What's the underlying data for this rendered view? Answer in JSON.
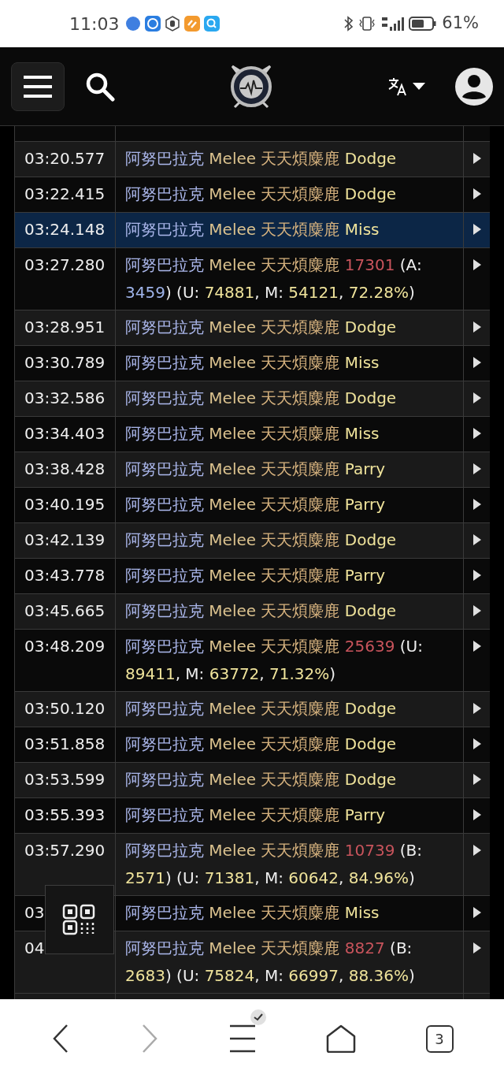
{
  "status_bar": {
    "time": "11:03",
    "battery": "61%"
  },
  "log": {
    "rows": [
      {
        "time": "03:20.577",
        "selected": false,
        "segments": [
          {
            "kind": "source",
            "text": "阿努巴拉克"
          },
          {
            "kind": "ability",
            "text": "Melee"
          },
          {
            "kind": "target",
            "text": "天天煩麋鹿"
          },
          {
            "kind": "result",
            "text": "Dodge"
          }
        ]
      },
      {
        "time": "03:22.415",
        "selected": false,
        "segments": [
          {
            "kind": "source",
            "text": "阿努巴拉克"
          },
          {
            "kind": "ability",
            "text": "Melee"
          },
          {
            "kind": "target",
            "text": "天天煩麋鹿"
          },
          {
            "kind": "result",
            "text": "Dodge"
          }
        ]
      },
      {
        "time": "03:24.148",
        "selected": true,
        "segments": [
          {
            "kind": "source",
            "text": "阿努巴拉克"
          },
          {
            "kind": "ability",
            "text": "Melee"
          },
          {
            "kind": "target",
            "text": "天天煩麋鹿"
          },
          {
            "kind": "result",
            "text": "Miss"
          }
        ]
      },
      {
        "time": "03:27.280",
        "selected": false,
        "segments": [
          {
            "kind": "source",
            "text": "阿努巴拉克"
          },
          {
            "kind": "ability",
            "text": "Melee"
          },
          {
            "kind": "target",
            "text": "天天煩麋鹿"
          },
          {
            "kind": "damage",
            "text": "17301"
          },
          {
            "kind": "plain",
            "text": "(A:"
          },
          {
            "kind": "absorb",
            "text": "3459"
          },
          {
            "kind": "plain",
            "text": ")"
          },
          {
            "kind": "plain",
            "text": "(U:"
          },
          {
            "kind": "number",
            "text": "74881"
          },
          {
            "kind": "plain",
            "text": ", M:"
          },
          {
            "kind": "number",
            "text": "54121"
          },
          {
            "kind": "plain",
            "text": ","
          },
          {
            "kind": "number",
            "text": "72.28%"
          },
          {
            "kind": "plain",
            "text": ")"
          }
        ]
      },
      {
        "time": "03:28.951",
        "selected": false,
        "segments": [
          {
            "kind": "source",
            "text": "阿努巴拉克"
          },
          {
            "kind": "ability",
            "text": "Melee"
          },
          {
            "kind": "target",
            "text": "天天煩麋鹿"
          },
          {
            "kind": "result",
            "text": "Dodge"
          }
        ]
      },
      {
        "time": "03:30.789",
        "selected": false,
        "segments": [
          {
            "kind": "source",
            "text": "阿努巴拉克"
          },
          {
            "kind": "ability",
            "text": "Melee"
          },
          {
            "kind": "target",
            "text": "天天煩麋鹿"
          },
          {
            "kind": "result",
            "text": "Miss"
          }
        ]
      },
      {
        "time": "03:32.586",
        "selected": false,
        "segments": [
          {
            "kind": "source",
            "text": "阿努巴拉克"
          },
          {
            "kind": "ability",
            "text": "Melee"
          },
          {
            "kind": "target",
            "text": "天天煩麋鹿"
          },
          {
            "kind": "result",
            "text": "Dodge"
          }
        ]
      },
      {
        "time": "03:34.403",
        "selected": false,
        "segments": [
          {
            "kind": "source",
            "text": "阿努巴拉克"
          },
          {
            "kind": "ability",
            "text": "Melee"
          },
          {
            "kind": "target",
            "text": "天天煩麋鹿"
          },
          {
            "kind": "result",
            "text": "Miss"
          }
        ]
      },
      {
        "time": "03:38.428",
        "selected": false,
        "segments": [
          {
            "kind": "source",
            "text": "阿努巴拉克"
          },
          {
            "kind": "ability",
            "text": "Melee"
          },
          {
            "kind": "target",
            "text": "天天煩麋鹿"
          },
          {
            "kind": "result",
            "text": "Parry"
          }
        ]
      },
      {
        "time": "03:40.195",
        "selected": false,
        "segments": [
          {
            "kind": "source",
            "text": "阿努巴拉克"
          },
          {
            "kind": "ability",
            "text": "Melee"
          },
          {
            "kind": "target",
            "text": "天天煩麋鹿"
          },
          {
            "kind": "result",
            "text": "Parry"
          }
        ]
      },
      {
        "time": "03:42.139",
        "selected": false,
        "segments": [
          {
            "kind": "source",
            "text": "阿努巴拉克"
          },
          {
            "kind": "ability",
            "text": "Melee"
          },
          {
            "kind": "target",
            "text": "天天煩麋鹿"
          },
          {
            "kind": "result",
            "text": "Dodge"
          }
        ]
      },
      {
        "time": "03:43.778",
        "selected": false,
        "segments": [
          {
            "kind": "source",
            "text": "阿努巴拉克"
          },
          {
            "kind": "ability",
            "text": "Melee"
          },
          {
            "kind": "target",
            "text": "天天煩麋鹿"
          },
          {
            "kind": "result",
            "text": "Parry"
          }
        ]
      },
      {
        "time": "03:45.665",
        "selected": false,
        "segments": [
          {
            "kind": "source",
            "text": "阿努巴拉克"
          },
          {
            "kind": "ability",
            "text": "Melee"
          },
          {
            "kind": "target",
            "text": "天天煩麋鹿"
          },
          {
            "kind": "result",
            "text": "Dodge"
          }
        ]
      },
      {
        "time": "03:48.209",
        "selected": false,
        "segments": [
          {
            "kind": "source",
            "text": "阿努巴拉克"
          },
          {
            "kind": "ability",
            "text": "Melee"
          },
          {
            "kind": "target",
            "text": "天天煩麋鹿"
          },
          {
            "kind": "damage",
            "text": "25639"
          },
          {
            "kind": "plain",
            "text": "(U:"
          },
          {
            "kind": "number",
            "text": "89411"
          },
          {
            "kind": "plain",
            "text": ", M:"
          },
          {
            "kind": "number",
            "text": "63772"
          },
          {
            "kind": "plain",
            "text": ","
          },
          {
            "kind": "number",
            "text": "71.32%"
          },
          {
            "kind": "plain",
            "text": ")"
          }
        ]
      },
      {
        "time": "03:50.120",
        "selected": false,
        "segments": [
          {
            "kind": "source",
            "text": "阿努巴拉克"
          },
          {
            "kind": "ability",
            "text": "Melee"
          },
          {
            "kind": "target",
            "text": "天天煩麋鹿"
          },
          {
            "kind": "result",
            "text": "Dodge"
          }
        ]
      },
      {
        "time": "03:51.858",
        "selected": false,
        "segments": [
          {
            "kind": "source",
            "text": "阿努巴拉克"
          },
          {
            "kind": "ability",
            "text": "Melee"
          },
          {
            "kind": "target",
            "text": "天天煩麋鹿"
          },
          {
            "kind": "result",
            "text": "Dodge"
          }
        ]
      },
      {
        "time": "03:53.599",
        "selected": false,
        "segments": [
          {
            "kind": "source",
            "text": "阿努巴拉克"
          },
          {
            "kind": "ability",
            "text": "Melee"
          },
          {
            "kind": "target",
            "text": "天天煩麋鹿"
          },
          {
            "kind": "result",
            "text": "Dodge"
          }
        ]
      },
      {
        "time": "03:55.393",
        "selected": false,
        "segments": [
          {
            "kind": "source",
            "text": "阿努巴拉克"
          },
          {
            "kind": "ability",
            "text": "Melee"
          },
          {
            "kind": "target",
            "text": "天天煩麋鹿"
          },
          {
            "kind": "result",
            "text": "Parry"
          }
        ]
      },
      {
        "time": "03:57.290",
        "selected": false,
        "segments": [
          {
            "kind": "source",
            "text": "阿努巴拉克"
          },
          {
            "kind": "ability",
            "text": "Melee"
          },
          {
            "kind": "target",
            "text": "天天煩麋鹿"
          },
          {
            "kind": "damage",
            "text": "10739"
          },
          {
            "kind": "plain",
            "text": "(B:"
          },
          {
            "kind": "number",
            "text": "2571"
          },
          {
            "kind": "plain",
            "text": ")"
          },
          {
            "kind": "plain",
            "text": "(U:"
          },
          {
            "kind": "number",
            "text": "71381"
          },
          {
            "kind": "plain",
            "text": ", M:"
          },
          {
            "kind": "number",
            "text": "60642"
          },
          {
            "kind": "plain",
            "text": ","
          },
          {
            "kind": "number",
            "text": "84.96%"
          },
          {
            "kind": "plain",
            "text": ")"
          }
        ]
      },
      {
        "time": "03",
        "selected": false,
        "segments": [
          {
            "kind": "source",
            "text": "阿努巴拉克"
          },
          {
            "kind": "ability",
            "text": "Melee"
          },
          {
            "kind": "target",
            "text": "天天煩麋鹿"
          },
          {
            "kind": "result",
            "text": "Miss"
          }
        ]
      },
      {
        "time": "04",
        "selected": false,
        "segments": [
          {
            "kind": "source",
            "text": "阿努巴拉克"
          },
          {
            "kind": "ability",
            "text": "Melee"
          },
          {
            "kind": "target",
            "text": "天天煩麋鹿"
          },
          {
            "kind": "damage",
            "text": "8827"
          },
          {
            "kind": "plain",
            "text": "(B:"
          },
          {
            "kind": "number",
            "text": "2683"
          },
          {
            "kind": "plain",
            "text": ")"
          },
          {
            "kind": "plain",
            "text": "(U:"
          },
          {
            "kind": "number",
            "text": "75824"
          },
          {
            "kind": "plain",
            "text": ", M:"
          },
          {
            "kind": "number",
            "text": "66997"
          },
          {
            "kind": "plain",
            "text": ","
          },
          {
            "kind": "number",
            "text": "88.36%"
          },
          {
            "kind": "plain",
            "text": ")"
          }
        ]
      }
    ]
  },
  "browser_bar": {
    "tab_count": "3",
    "forward_disabled": true
  }
}
